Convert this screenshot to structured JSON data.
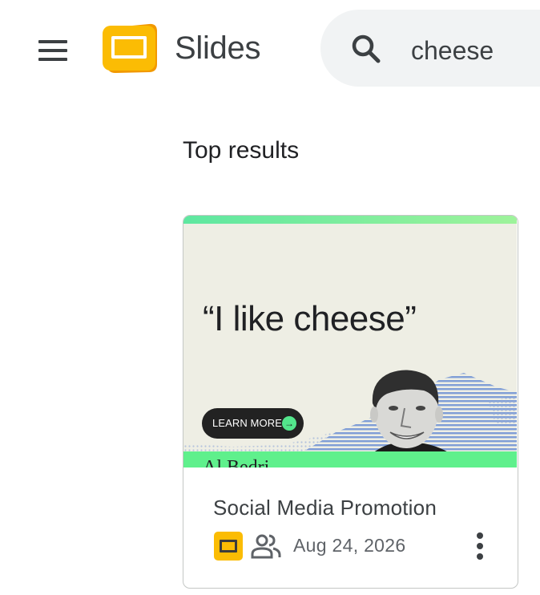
{
  "header": {
    "menu_icon": "hamburger-menu-icon",
    "app_name": "Slides",
    "app_logo_icon": "google-slides-logo-icon",
    "search": {
      "icon": "search-icon",
      "value": "cheese"
    }
  },
  "main": {
    "section_title": "Top results",
    "results": [
      {
        "thumbnail": {
          "quote": "“I like cheese”",
          "button_label": "LEARN MORE",
          "button_arrow": "→",
          "footer_text": "Al Bedri"
        },
        "title": "Social Media Promotion",
        "file_type_icon": "slides-file-icon",
        "shared_icon": "shared-people-icon",
        "date": "Aug 24, 2026",
        "more_icon": "more-vert-icon"
      }
    ]
  },
  "colors": {
    "slides_yellow": "#fbbc04",
    "search_bg": "#f1f3f4",
    "thumb_bg": "#eeeee4",
    "accent_green": "#5ff08c",
    "halftone_blue": "#6b8fd4"
  }
}
